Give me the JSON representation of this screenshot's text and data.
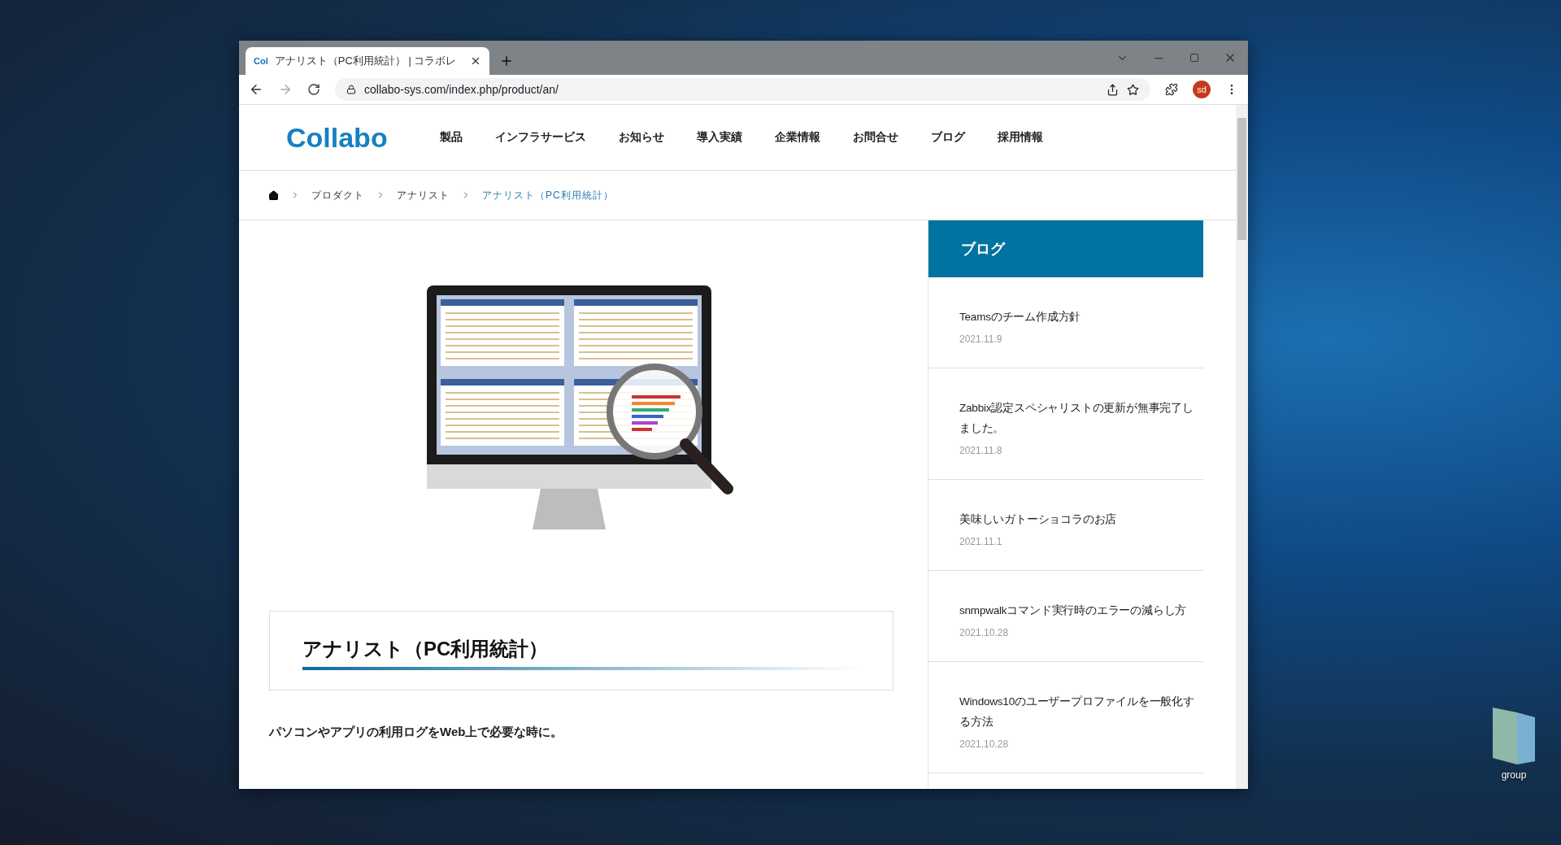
{
  "browser": {
    "tabs": [
      {
        "favicon": "Col",
        "title": "アナリスト（PC利用統計） | コラボレ",
        "selected": true
      }
    ],
    "url": "collabo-sys.com/index.php/product/an/",
    "profile": "sd"
  },
  "site": {
    "logo": "Collabo",
    "nav": [
      "製品",
      "インフラサービス",
      "お知らせ",
      "導入実績",
      "企業情報",
      "お問合せ",
      "ブログ",
      "採用情報"
    ],
    "breadcrumb": [
      {
        "label": "プロダクト",
        "current": false
      },
      {
        "label": "アナリスト",
        "current": false
      },
      {
        "label": "アナリスト（PC利用統計）",
        "current": true
      }
    ],
    "page_title": "アナリスト（PC利用統計）",
    "lead": "パソコンやアプリの利用ログをWeb上で必要な時に。",
    "sidebar": {
      "title": "ブログ",
      "posts": [
        {
          "title": "Teamsのチーム作成方針",
          "date": "2021.11.9"
        },
        {
          "title": "Zabbix認定スペシャリストの更新が無事完了しました。",
          "date": "2021.11.8"
        },
        {
          "title": "美味しいガトーショコラのお店",
          "date": "2021.11.1"
        },
        {
          "title": "snmpwalkコマンド実行時のエラーの減らし方",
          "date": "2021.10.28"
        },
        {
          "title": "Windows10のユーザープロファイルを一般化する方法",
          "date": "2021.10.28"
        }
      ]
    }
  },
  "desktop_icons": [
    {
      "label": "group"
    }
  ]
}
